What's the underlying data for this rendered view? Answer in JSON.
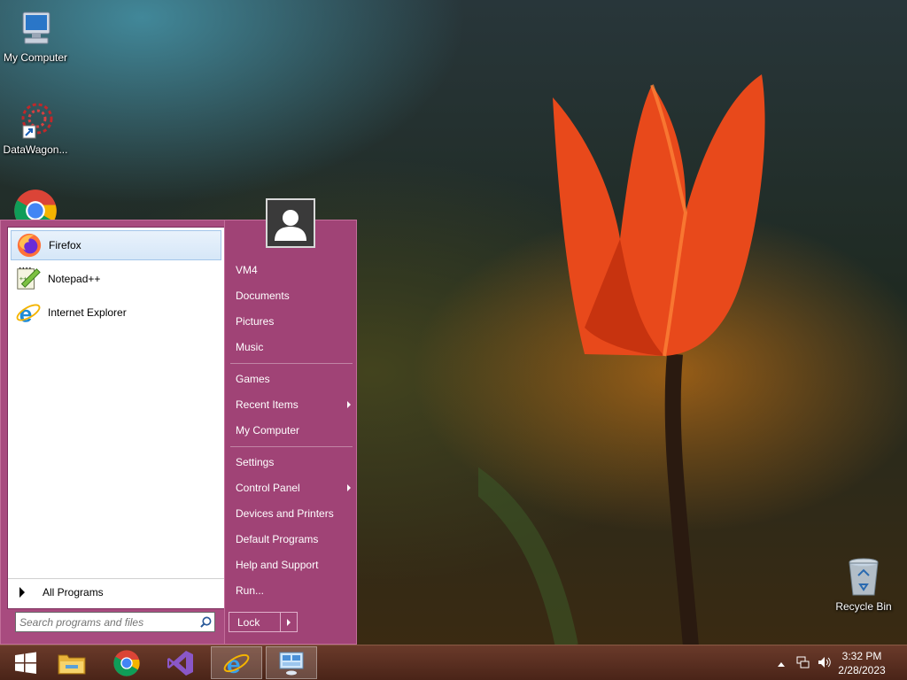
{
  "desktop": {
    "icons": [
      {
        "label": "My Computer",
        "icon": "computer-icon"
      },
      {
        "label": "DataWagon...",
        "icon": "datawagon-icon"
      },
      {
        "label": "",
        "icon": "chrome-icon"
      },
      {
        "label": "Recycle Bin",
        "icon": "recycle-bin-icon"
      }
    ]
  },
  "start_menu": {
    "programs": [
      {
        "label": "Firefox",
        "icon": "firefox-icon",
        "selected": true
      },
      {
        "label": "Notepad++",
        "icon": "notepad-plus-plus-icon",
        "selected": false
      },
      {
        "label": "Internet Explorer",
        "icon": "internet-explorer-icon",
        "selected": false
      }
    ],
    "all_programs_label": "All Programs",
    "search_placeholder": "Search programs and files",
    "right_items": [
      {
        "label": "VM4",
        "submenu": false
      },
      {
        "label": "Documents",
        "submenu": false
      },
      {
        "label": "Pictures",
        "submenu": false
      },
      {
        "label": "Music",
        "submenu": false
      },
      {
        "label": "Games",
        "submenu": false
      },
      {
        "label": "Recent Items",
        "submenu": true
      },
      {
        "label": "My Computer",
        "submenu": false
      },
      {
        "label": "Settings",
        "submenu": false
      },
      {
        "label": "Control Panel",
        "submenu": true
      },
      {
        "label": "Devices and Printers",
        "submenu": false
      },
      {
        "label": "Default Programs",
        "submenu": false
      },
      {
        "label": "Help and Support",
        "submenu": false
      },
      {
        "label": "Run...",
        "submenu": false
      }
    ],
    "lock_label": "Lock"
  },
  "taskbar": {
    "buttons": [
      {
        "icon": "windows-start-icon",
        "active": false
      },
      {
        "icon": "file-explorer-icon",
        "active": false
      },
      {
        "icon": "chrome-icon",
        "active": false
      },
      {
        "icon": "visual-studio-icon",
        "active": false
      },
      {
        "icon": "internet-explorer-icon",
        "active": true
      },
      {
        "icon": "remote-desktop-icon",
        "active": true
      }
    ],
    "tray_icons": [
      "show-hidden-icons-icon",
      "network-icon",
      "volume-icon"
    ],
    "clock": {
      "time": "3:32 PM",
      "date": "2/28/2023"
    }
  },
  "colors": {
    "start_left_bg": "#a84b7f",
    "start_right_bg": "#a04376",
    "taskbar_bg": "#5a2e20"
  }
}
